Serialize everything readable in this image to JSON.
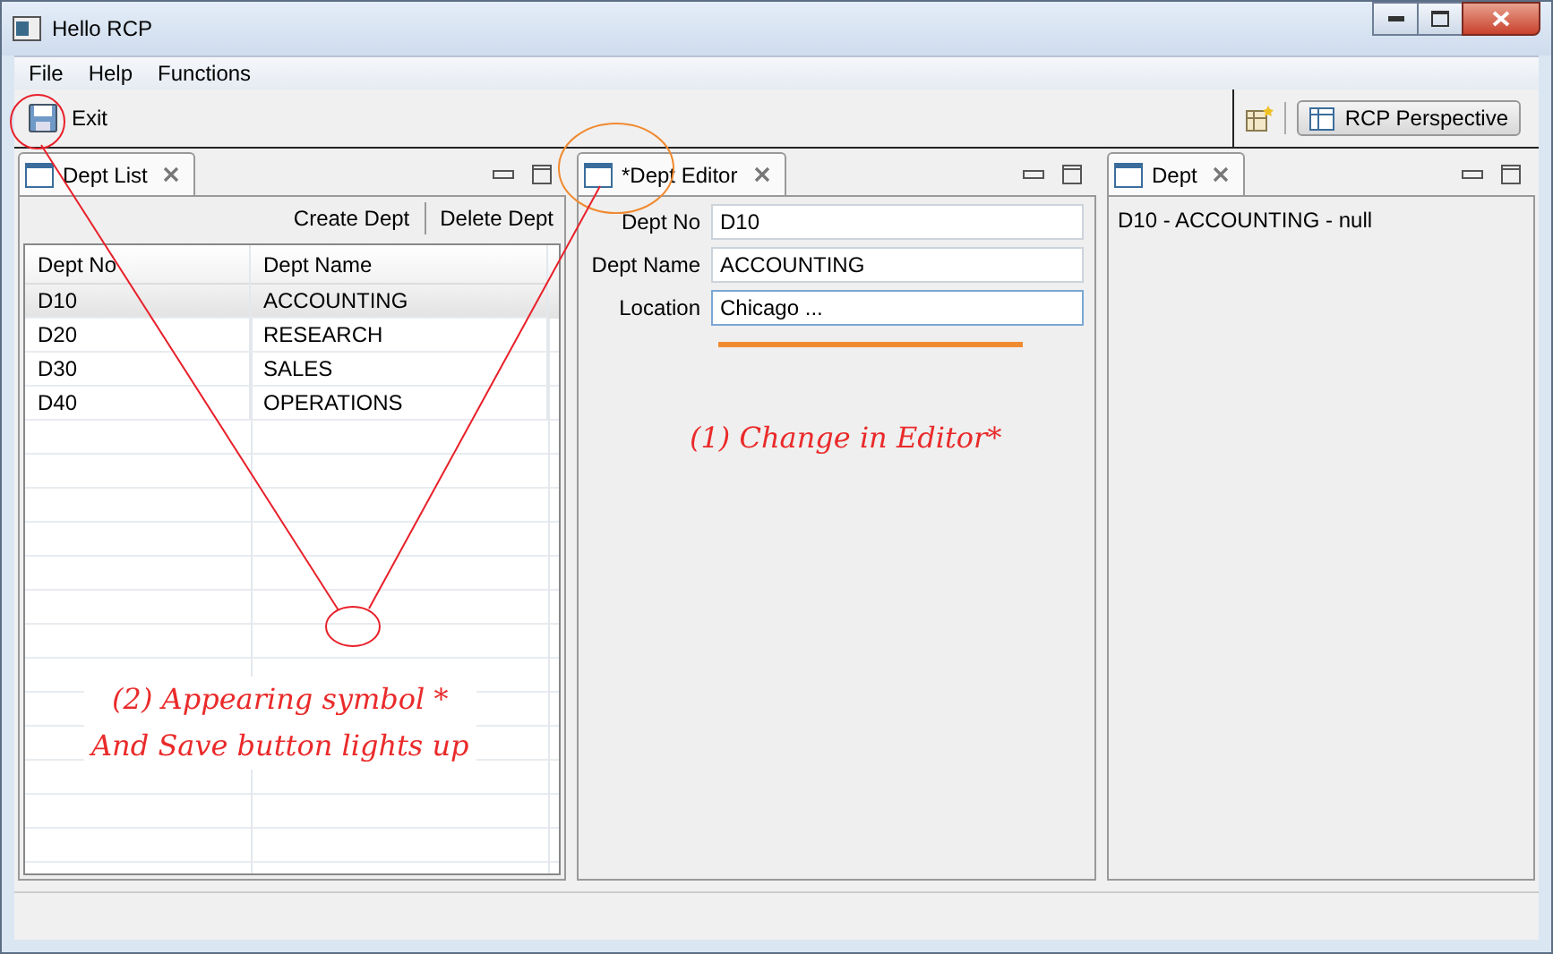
{
  "window": {
    "title": "Hello RCP"
  },
  "menu": [
    "File",
    "Help",
    "Functions"
  ],
  "toolbar": {
    "save_enabled": true,
    "exit_label": "Exit",
    "perspective": "RCP Perspective"
  },
  "dept_list": {
    "tab": "Dept List",
    "actions": [
      "Create Dept",
      "Delete Dept"
    ],
    "columns": [
      "Dept No",
      "Dept Name"
    ],
    "rows": [
      {
        "no": "D10",
        "name": "ACCOUNTING",
        "selected": true
      },
      {
        "no": "D20",
        "name": "RESEARCH",
        "selected": false
      },
      {
        "no": "D30",
        "name": "SALES",
        "selected": false
      },
      {
        "no": "D40",
        "name": "OPERATIONS",
        "selected": false
      }
    ]
  },
  "dept_editor": {
    "tab": "*Dept Editor",
    "fields": [
      {
        "label": "Dept No",
        "value": "D10",
        "focused": false
      },
      {
        "label": "Dept Name",
        "value": "ACCOUNTING",
        "focused": false
      },
      {
        "label": "Location",
        "value": "Chicago ...",
        "focused": true
      }
    ]
  },
  "dept_view": {
    "tab": "Dept",
    "text": "D10 - ACCOUNTING - null"
  },
  "annotations": [
    "(1) Change in Editor*",
    "(2) Appearing symbol *",
    "And Save button lights up"
  ]
}
